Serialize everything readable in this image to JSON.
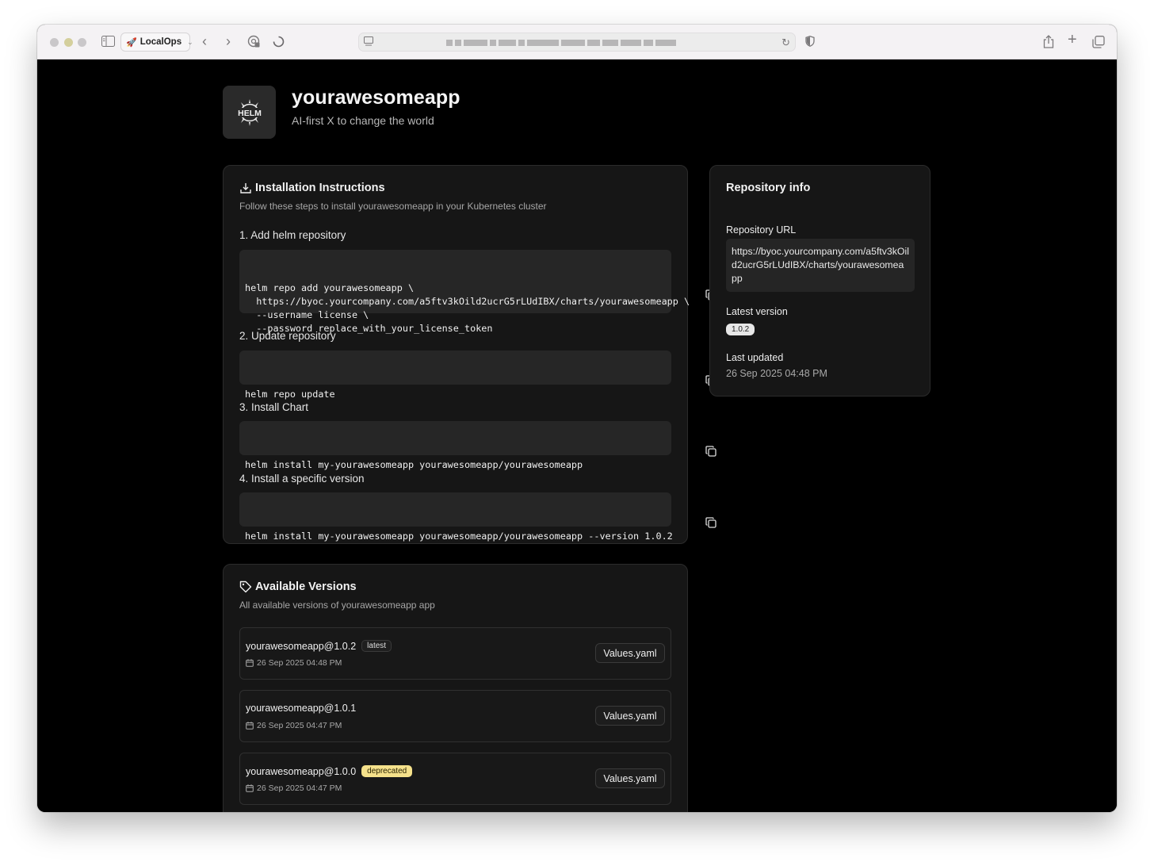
{
  "browser": {
    "profile_label": "LocalOps"
  },
  "app": {
    "title": "yourawesomeapp",
    "subtitle": "AI-first X to change the world",
    "logo_text": "HELM"
  },
  "install": {
    "title": "Installation Instructions",
    "description": "Follow these steps to install yourawesomeapp in your Kubernetes cluster",
    "steps": [
      {
        "title": "1. Add helm repository",
        "code": "helm repo add yourawesomeapp \\\n  https://byoc.yourcompany.com/a5ftv3kOild2ucrG5rLUdIBX/charts/yourawesomeapp \\\n  --username license \\\n  --password replace_with_your_license_token"
      },
      {
        "title": "2. Update repository",
        "code": "helm repo update"
      },
      {
        "title": "3. Install Chart",
        "code": "helm install my-yourawesomeapp yourawesomeapp/yourawesomeapp"
      },
      {
        "title": "4. Install a specific version",
        "code": "helm install my-yourawesomeapp yourawesomeapp/yourawesomeapp --version 1.0.2"
      }
    ]
  },
  "versions": {
    "title": "Available Versions",
    "description": "All available versions of yourawesomeapp app",
    "button_label": "Values.yaml",
    "items": [
      {
        "name": "yourawesomeapp@1.0.2",
        "tag": "latest",
        "date": "26 Sep 2025 04:48 PM"
      },
      {
        "name": "yourawesomeapp@1.0.1",
        "tag": "",
        "date": "26 Sep 2025 04:47 PM"
      },
      {
        "name": "yourawesomeapp@1.0.0",
        "tag": "deprecated",
        "date": "26 Sep 2025 04:47 PM"
      }
    ]
  },
  "repo_info": {
    "title": "Repository info",
    "url_label": "Repository URL",
    "url": "https://byoc.yourcompany.com/a5ftv3kOild2ucrG5rLUdIBX/charts/yourawesomeapp",
    "latest_label": "Latest version",
    "latest_version": "1.0.2",
    "updated_label": "Last updated",
    "updated_value": "26 Sep 2025 04:48 PM"
  },
  "colors": {
    "page_bg": "#000000",
    "card_bg": "#161616",
    "code_bg": "#262626",
    "deprecated_badge": "#f5e18b"
  }
}
